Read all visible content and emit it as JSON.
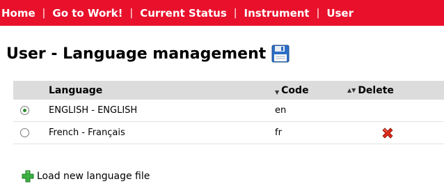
{
  "nav": {
    "items": [
      "Home",
      "Go to Work!",
      "Current Status",
      "Instrument",
      "User"
    ],
    "separator": "|"
  },
  "page": {
    "title": "User - Language management"
  },
  "table": {
    "headers": {
      "language": "Language",
      "code": "Code",
      "delete": "Delete"
    },
    "rows": [
      {
        "language": "ENGLISH - ENGLISH",
        "code": "en",
        "selected": true,
        "deletable": false
      },
      {
        "language": "French - Français",
        "code": "fr",
        "selected": false,
        "deletable": true
      }
    ]
  },
  "actions": {
    "load_label": "Load new language file"
  },
  "icons": {
    "save": "floppy-disk-icon",
    "delete": "red-x-icon",
    "add": "green-plus-icon"
  },
  "colors": {
    "navbar": "#e8102b",
    "nav_text": "#ffffff",
    "header_bg": "#dcdcdc",
    "radio_dot": "#2e8b2e"
  }
}
